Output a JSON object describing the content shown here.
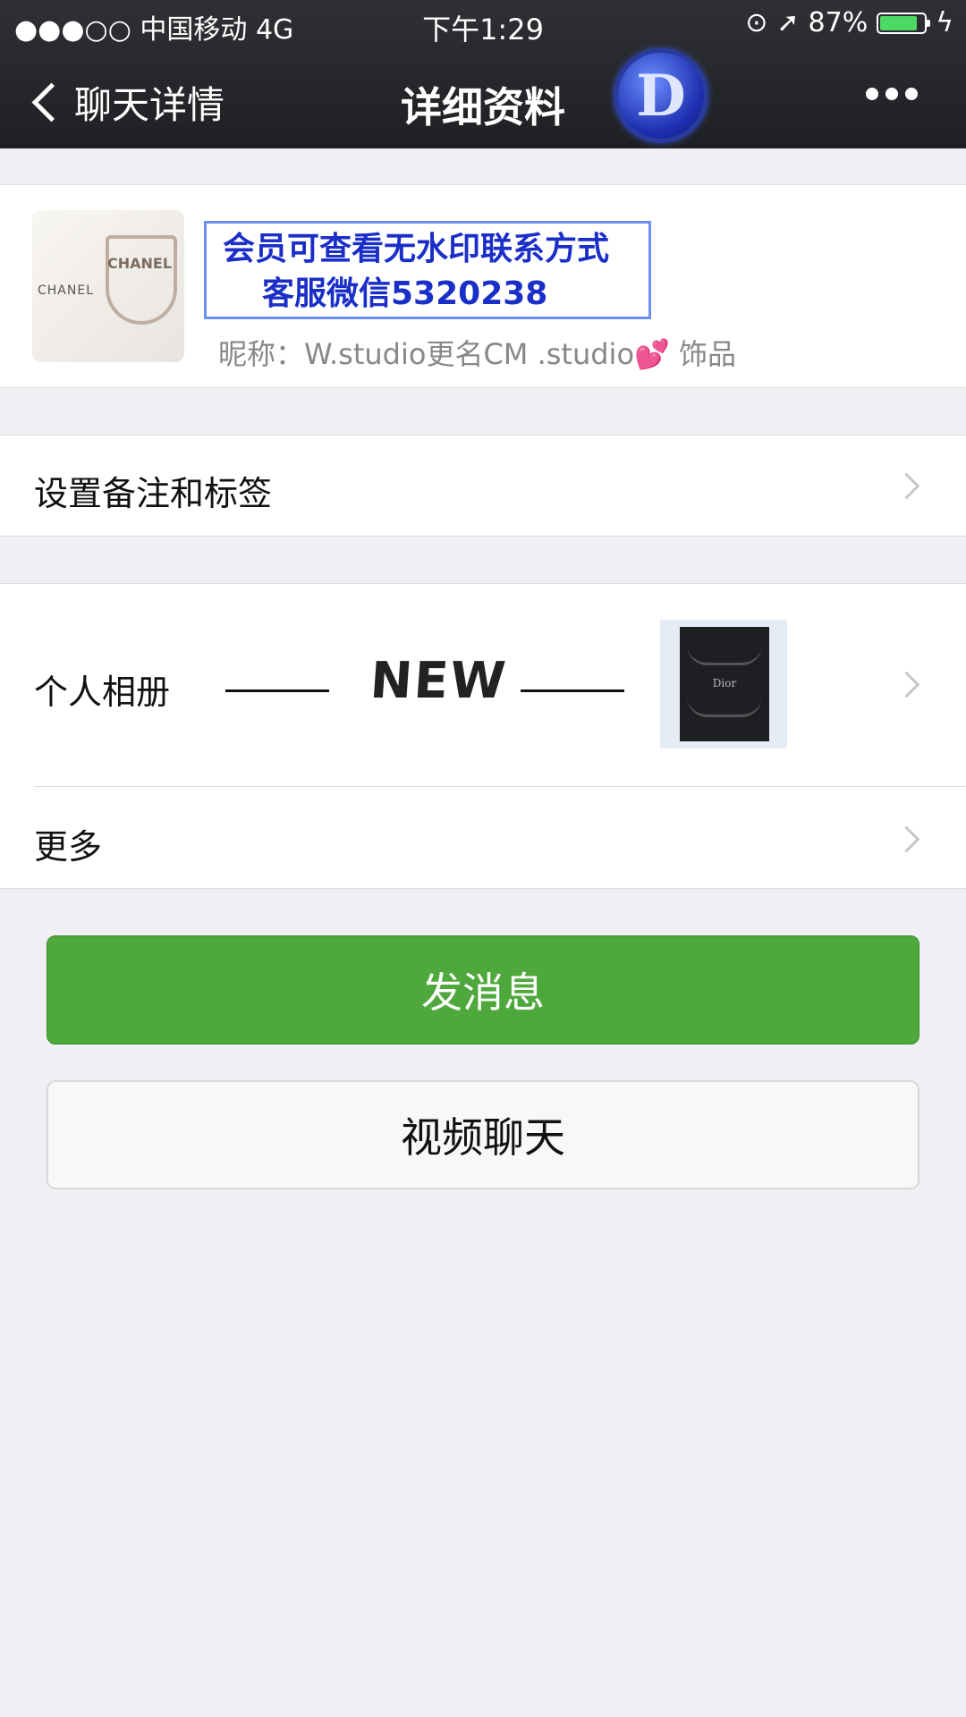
{
  "status_bar": {
    "carrier": "●●●○○ 中国移动   4G",
    "time": "下午1:29",
    "battery_text": "87%",
    "battery_level": 0.87
  },
  "nav": {
    "back_label": "聊天详情",
    "title": "详细资料",
    "logo_letter": "D"
  },
  "profile": {
    "promo_line1": "会员可查看无水印联系方式",
    "promo_line2": "客服微信5320238",
    "nickname_prefix": "昵称：",
    "nickname": "W.studio更名CM .studio",
    "nickname_suffix": "饰品",
    "avatar_brand": "CHANEL"
  },
  "rows": {
    "remark_label": "设置备注和标签",
    "album_label": "个人相册",
    "album_overlay": "NEW",
    "album_thumb_text": "Dior",
    "more_label": "更多"
  },
  "buttons": {
    "send": "发消息",
    "video": "视频聊天"
  },
  "colors": {
    "nav_bg": "#26272a",
    "send_green": "#4ea83b",
    "promo_blue": "#1a2ec8",
    "page_bg": "#efeff4"
  }
}
